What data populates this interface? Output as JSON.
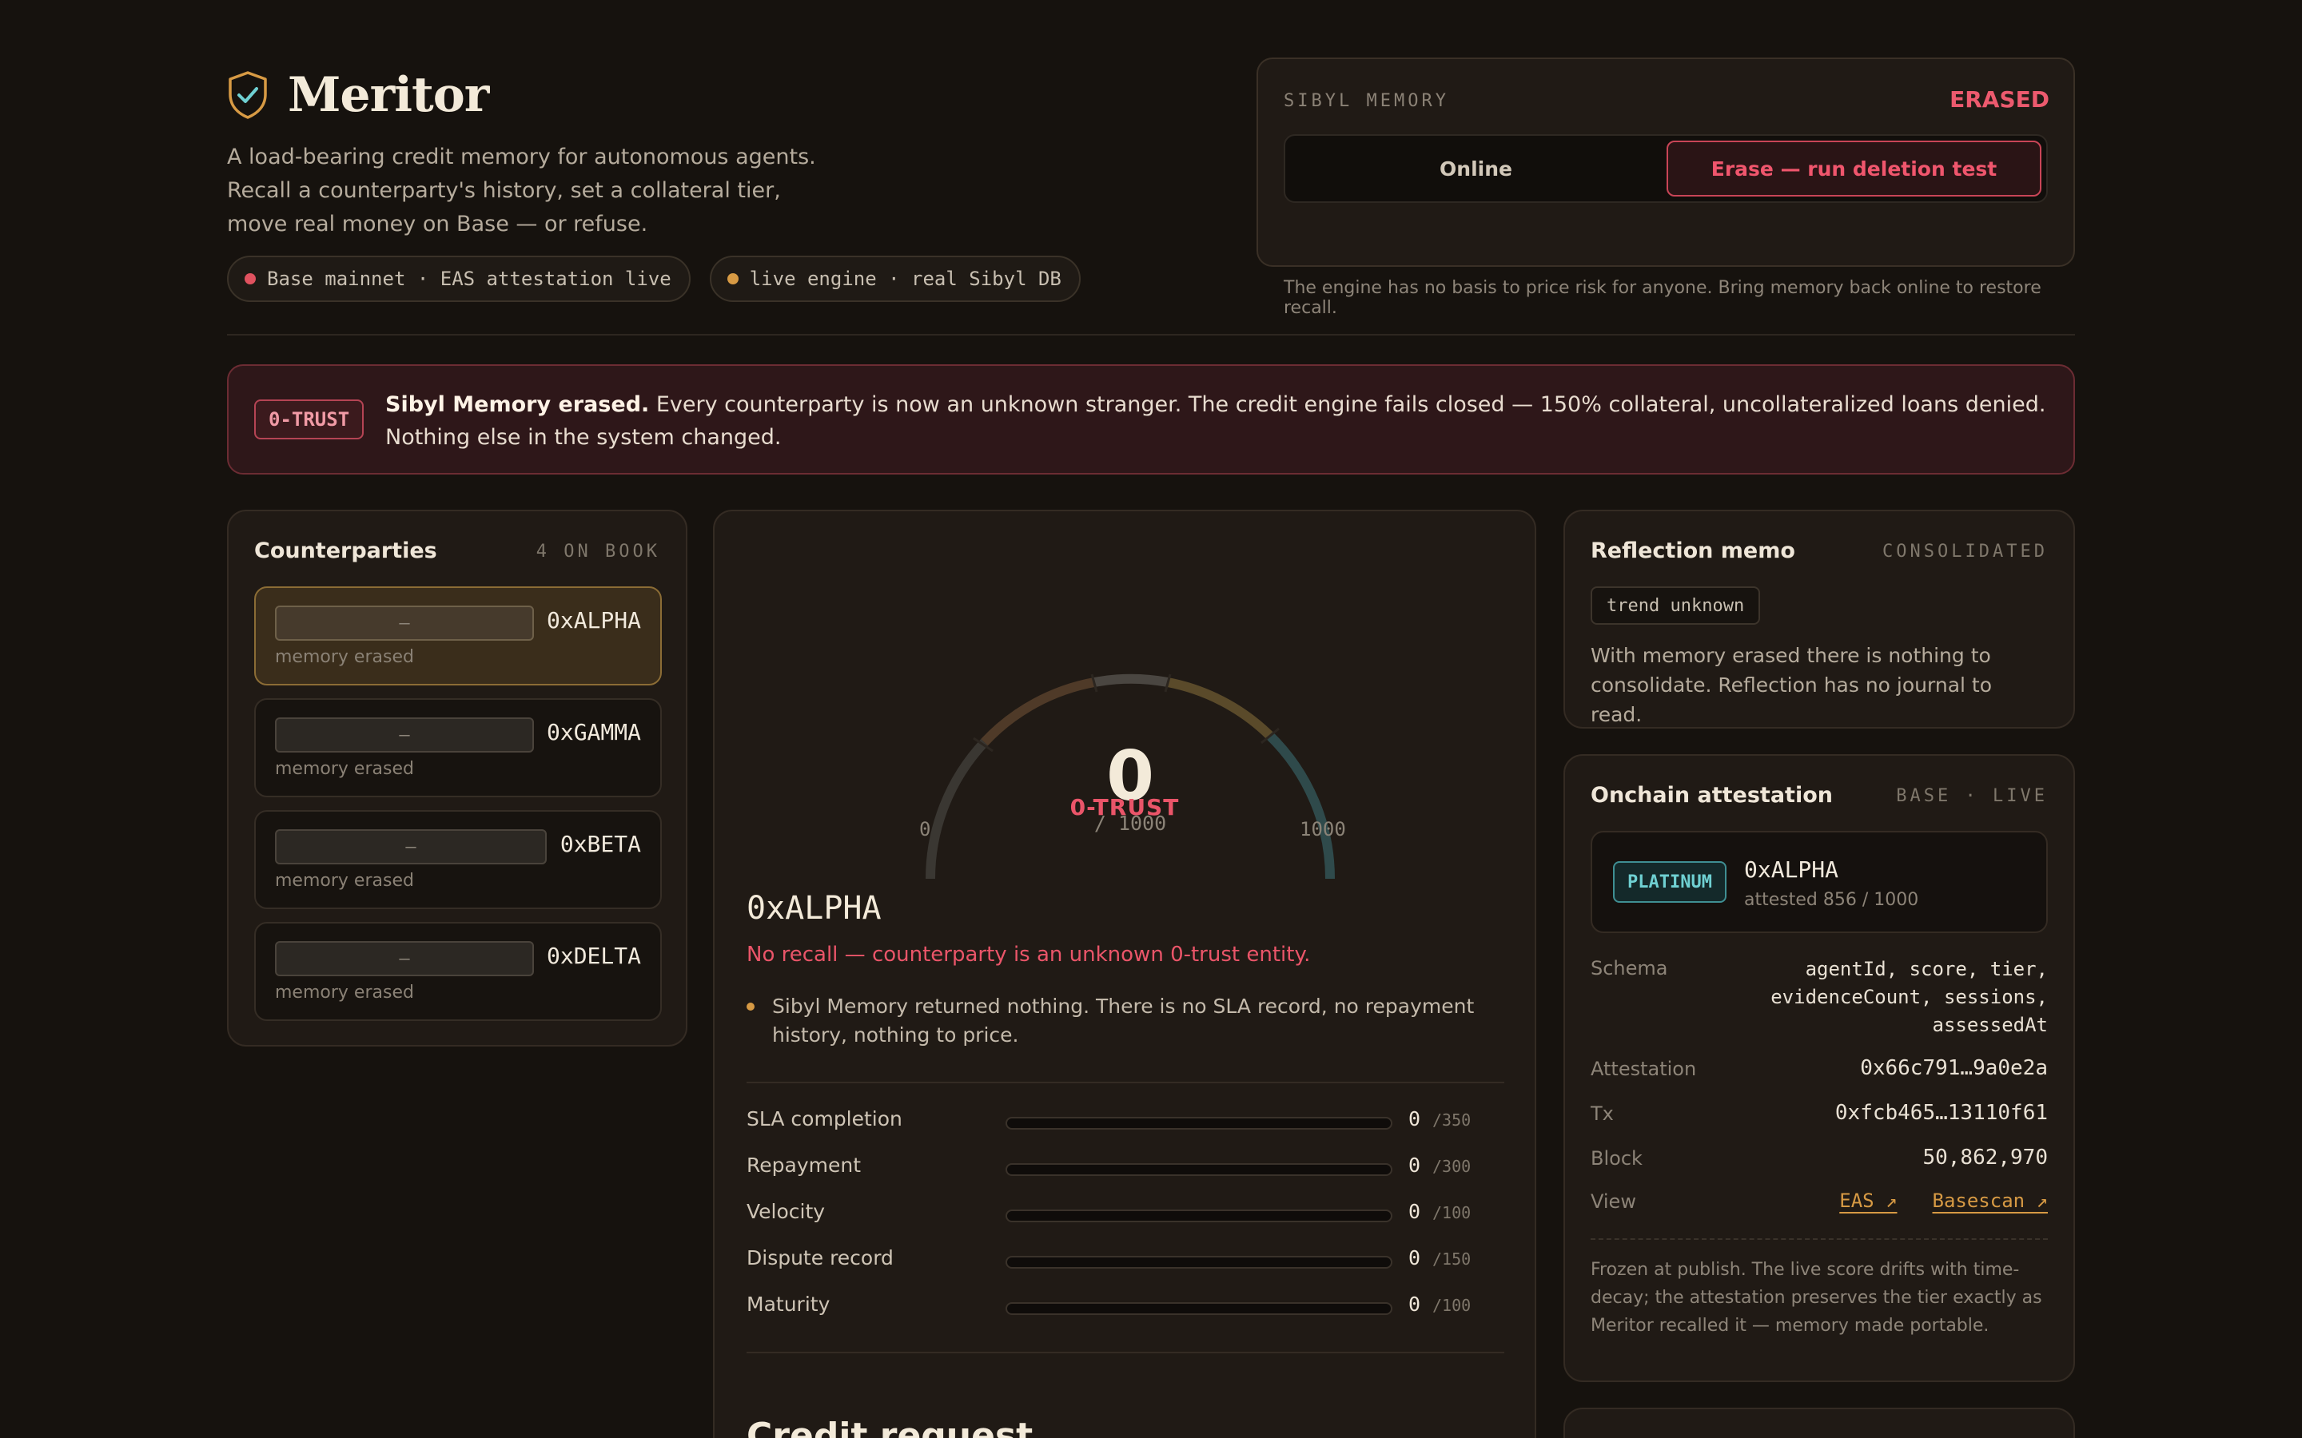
{
  "brand": {
    "title": "Meritor",
    "tagline": "A load-bearing credit memory for autonomous agents. Recall a counterparty's history, set a collateral tier, move real money on Base — or refuse.",
    "pills": [
      {
        "text": "Base mainnet · EAS attestation live",
        "dot_color": "#e0525f"
      },
      {
        "text": "live engine · real Sibyl DB",
        "dot_color": "#d79a44"
      }
    ]
  },
  "memory": {
    "label": "SIBYL MEMORY",
    "status": "ERASED",
    "options": [
      "Online",
      "Erase — run deletion test"
    ],
    "active_option": "Erase — run deletion test",
    "note": "The engine has no basis to price risk for anyone. Bring memory back online to restore recall."
  },
  "banner": {
    "badge": "0-TRUST",
    "title": "Sibyl Memory erased.",
    "text": "Every counterparty is now an unknown stranger. The credit engine fails closed — 150% collateral, uncollateralized loans denied. Nothing else in the system changed."
  },
  "counterparties": {
    "title": "Counterparties",
    "count_label": "4 ON BOOK",
    "items": [
      {
        "name": "0xALPHA",
        "bar_text": "–",
        "status": "memory erased",
        "selected": true
      },
      {
        "name": "0xGAMMA",
        "bar_text": "–",
        "status": "memory erased",
        "selected": false
      },
      {
        "name": "0xBETA",
        "bar_text": "–",
        "status": "memory erased",
        "selected": false
      },
      {
        "name": "0xDELTA",
        "bar_text": "–",
        "status": "memory erased",
        "selected": false
      }
    ]
  },
  "score": {
    "value": "0",
    "out_of": "/ 1000",
    "tier": "0-TRUST",
    "min_label": "0",
    "max_label": "1000",
    "counterparty": "0xALPHA",
    "warning": "No recall — counterparty is an unknown 0-trust entity.",
    "bullet": "Sibyl Memory returned nothing. There is no SLA record, no repayment history, nothing to price.",
    "factors": [
      {
        "label": "SLA completion",
        "value": 0,
        "max": 350,
        "max_label": "/350"
      },
      {
        "label": "Repayment",
        "value": 0,
        "max": 300,
        "max_label": "/300"
      },
      {
        "label": "Velocity",
        "value": 0,
        "max": 100,
        "max_label": "/100"
      },
      {
        "label": "Dispute record",
        "value": 0,
        "max": 150,
        "max_label": "/150"
      },
      {
        "label": "Maturity",
        "value": 0,
        "max": 100,
        "max_label": "/100"
      }
    ],
    "credit_request_title": "Credit request"
  },
  "reflection": {
    "title": "Reflection memo",
    "status": "CONSOLIDATED",
    "tag": "trend unknown",
    "text": "With memory erased there is nothing to consolidate. Reflection has no journal to read."
  },
  "attestation": {
    "title": "Onchain attestation",
    "status": "BASE · LIVE",
    "tier": "PLATINUM",
    "name": "0xALPHA",
    "sub": "attested 856 / 1000",
    "schema_label": "Schema",
    "schema_lines": [
      "agentId, score, tier,",
      "evidenceCount, sessions,",
      "assessedAt"
    ],
    "attestation_label": "Attestation",
    "attestation_value": "0x66c791…9a0e2a",
    "tx_label": "Tx",
    "tx_value": "0xfcb465…13110f61",
    "block_label": "Block",
    "block_value": "50,862,970",
    "view_label": "View",
    "links": [
      "EAS ↗",
      "Basescan ↗"
    ],
    "note": "Frozen at publish. The live score drifts with time-decay; the attestation preserves the tier exactly as Meritor recalled it — memory made portable."
  },
  "colors": {
    "accent": "#d79a44",
    "danger": "#ea5569",
    "teal": "#6fd0d2",
    "background": "#16120e"
  },
  "icons": {
    "brand": "shield-check-icon"
  }
}
